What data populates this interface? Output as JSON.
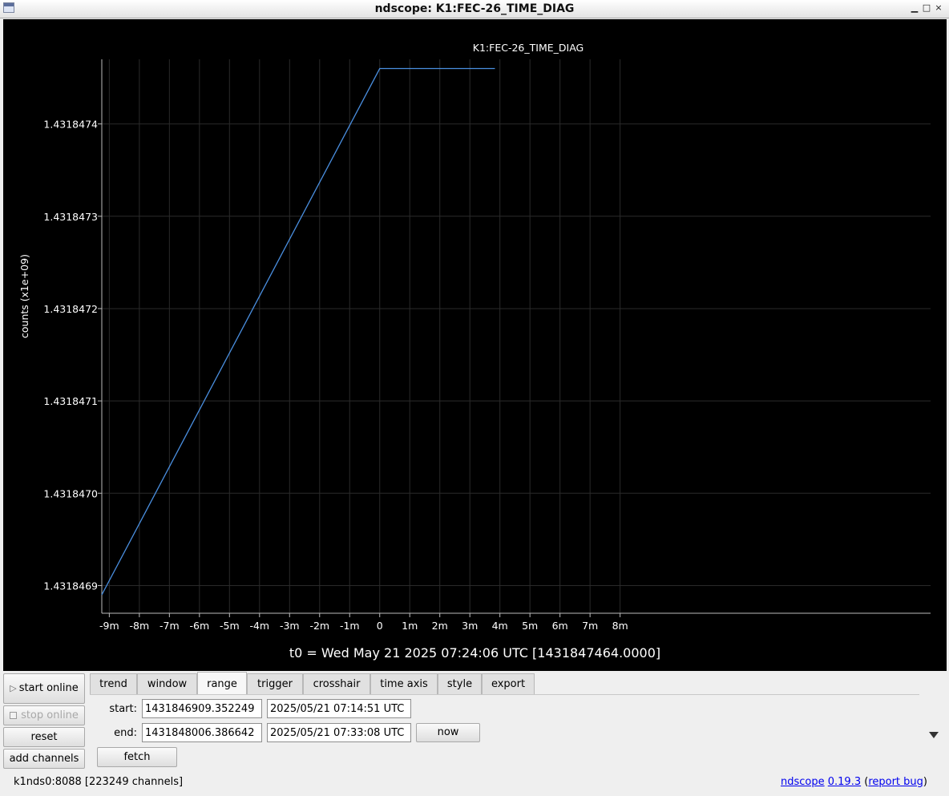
{
  "window": {
    "title": "ndscope: K1:FEC-26_TIME_DIAG",
    "min_glyph": "▁",
    "max_glyph": "□",
    "close_glyph": "×"
  },
  "plot": {
    "t0_label": "t0 = Wed May 21 2025 07:24:06 UTC [1431847464.0000]"
  },
  "chart_data": {
    "type": "line",
    "title": "K1:FEC-26_TIME_DIAG",
    "ylabel": "counts (x1e+09)",
    "xlabel": "",
    "grid": true,
    "line_color": "#4a8fe0",
    "background": "#000000",
    "xlim": [
      -555,
      1100
    ],
    "ylim": [
      1.43184687,
      1.43184747
    ],
    "x_ticks": [
      -540,
      -480,
      -420,
      -360,
      -300,
      -240,
      -180,
      -120,
      -60,
      0,
      60,
      120,
      180,
      240,
      300,
      360,
      420,
      480
    ],
    "x_tick_labels": [
      "-9m",
      "-8m",
      "-7m",
      "-6m",
      "-5m",
      "-4m",
      "-3m",
      "-2m",
      "-1m",
      "0",
      "1m",
      "2m",
      "3m",
      "4m",
      "5m",
      "6m",
      "7m",
      "8m"
    ],
    "y_ticks": [
      1.4318469,
      1.431847,
      1.4318471,
      1.4318472,
      1.4318473,
      1.4318474
    ],
    "y_tick_labels": [
      "1.4318469",
      "1.4318470",
      "1.4318471",
      "1.4318472",
      "1.4318473",
      "1.4318474"
    ],
    "series": [
      {
        "x": [
          -555,
          0,
          230
        ],
        "y": [
          1.43184689,
          1.43184746,
          1.43184746
        ]
      }
    ]
  },
  "tabs": [
    {
      "label": "trend",
      "active": false
    },
    {
      "label": "window",
      "active": false
    },
    {
      "label": "range",
      "active": true
    },
    {
      "label": "trigger",
      "active": false
    },
    {
      "label": "crosshair",
      "active": false
    },
    {
      "label": "time axis",
      "active": false
    },
    {
      "label": "style",
      "active": false
    },
    {
      "label": "export",
      "active": false
    }
  ],
  "controls": {
    "start_online": "start online",
    "stop_online": "stop online",
    "reset": "reset",
    "add_channels": "add channels"
  },
  "range": {
    "start_label": "start:",
    "start_gps": "1431846909.352249",
    "start_utc": "2025/05/21 07:14:51 UTC",
    "end_label": "end:",
    "end_gps": "1431848006.386642",
    "end_utc": "2025/05/21 07:33:08 UTC",
    "now_label": "now",
    "fetch_label": "fetch"
  },
  "status": {
    "server": "k1nds0:8088  [223249 channels]",
    "app_link": "ndscope",
    "version_link": "0.19.3",
    "bug_link": "report bug"
  }
}
